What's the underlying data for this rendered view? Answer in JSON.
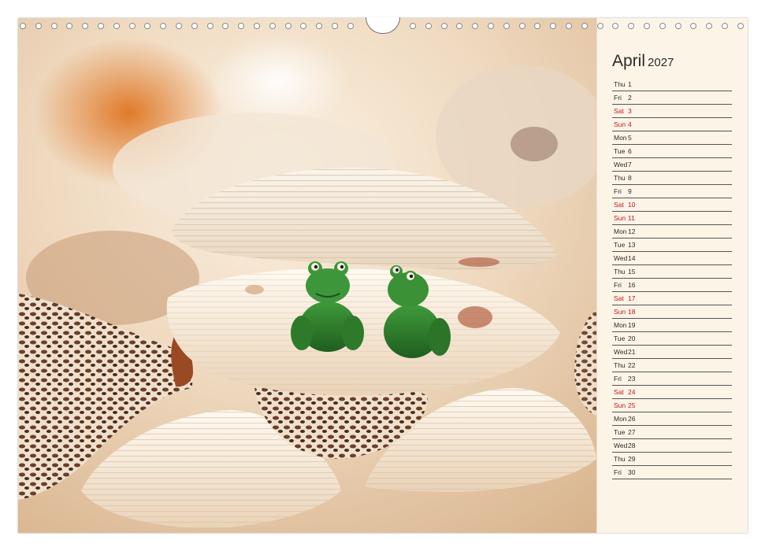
{
  "calendar": {
    "month": "April",
    "year": "2027",
    "days": [
      {
        "dow": "Thu",
        "day": "1",
        "weekend": false
      },
      {
        "dow": "Fri",
        "day": "2",
        "weekend": false
      },
      {
        "dow": "Sat",
        "day": "3",
        "weekend": true
      },
      {
        "dow": "Sun",
        "day": "4",
        "weekend": true
      },
      {
        "dow": "Mon",
        "day": "5",
        "weekend": false
      },
      {
        "dow": "Tue",
        "day": "6",
        "weekend": false
      },
      {
        "dow": "Wed",
        "day": "7",
        "weekend": false
      },
      {
        "dow": "Thu",
        "day": "8",
        "weekend": false
      },
      {
        "dow": "Fri",
        "day": "9",
        "weekend": false
      },
      {
        "dow": "Sat",
        "day": "10",
        "weekend": true
      },
      {
        "dow": "Sun",
        "day": "11",
        "weekend": true
      },
      {
        "dow": "Mon",
        "day": "12",
        "weekend": false
      },
      {
        "dow": "Tue",
        "day": "13",
        "weekend": false
      },
      {
        "dow": "Wed",
        "day": "14",
        "weekend": false
      },
      {
        "dow": "Thu",
        "day": "15",
        "weekend": false
      },
      {
        "dow": "Fri",
        "day": "16",
        "weekend": false
      },
      {
        "dow": "Sat",
        "day": "17",
        "weekend": true
      },
      {
        "dow": "Sun",
        "day": "18",
        "weekend": true
      },
      {
        "dow": "Mon",
        "day": "19",
        "weekend": false
      },
      {
        "dow": "Tue",
        "day": "20",
        "weekend": false
      },
      {
        "dow": "Wed",
        "day": "21",
        "weekend": false
      },
      {
        "dow": "Thu",
        "day": "22",
        "weekend": false
      },
      {
        "dow": "Fri",
        "day": "23",
        "weekend": false
      },
      {
        "dow": "Sat",
        "day": "24",
        "weekend": true
      },
      {
        "dow": "Sun",
        "day": "25",
        "weekend": true
      },
      {
        "dow": "Mon",
        "day": "26",
        "weekend": false
      },
      {
        "dow": "Tue",
        "day": "27",
        "weekend": false
      },
      {
        "dow": "Wed",
        "day": "28",
        "weekend": false
      },
      {
        "dow": "Thu",
        "day": "29",
        "weekend": false
      },
      {
        "dow": "Fri",
        "day": "30",
        "weekend": false
      }
    ]
  },
  "photo": {
    "subject": "two green frog figurines inside an open scallop shell among seashells"
  },
  "colors": {
    "weekend": "#c0171c",
    "text": "#2b2b2b",
    "panel_background": "#fcf4e6"
  }
}
